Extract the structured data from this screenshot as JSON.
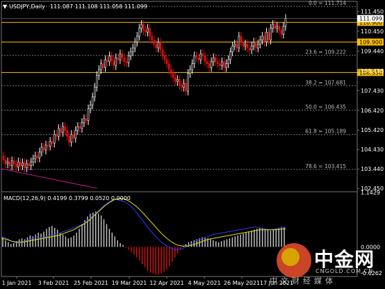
{
  "header": {
    "symbol": "USDJPY,Daily",
    "ohlc": "111.087 111.108 111.058 111.099",
    "macd_label": "MACD(12,26,9) 0.4199 0.3799 0.0520 0.0000"
  },
  "colors": {
    "bull": "#ffffff",
    "bear": "#e01010",
    "level": "#ffbf00",
    "grid": "#777777",
    "macd_line": "#2a3cff",
    "signal_line": "#e6e600",
    "trendline": "#c0188f"
  },
  "watermark": {
    "brand": "中金网",
    "site": "CNGOLD.COM.CN",
    "tagline": "中文财经媒体"
  },
  "chart_data": [
    {
      "type": "candlestick",
      "title": "USDJPY,Daily",
      "ylim": [
        102.28,
        111.97
      ],
      "y_ticks": [
        "111.450",
        "110.450",
        "109.440",
        "108.430",
        "107.430",
        "106.420",
        "105.420",
        "104.430",
        "103.440",
        "102.450"
      ],
      "x_ticks": [
        "1 Jan 2021",
        "3 Feb 2021",
        "25 Feb 2021",
        "19 Mar 2021",
        "12 Apr 2021",
        "4 May 2021",
        "26 May 2021",
        "17 Jun 2021"
      ],
      "last_price": "111.099",
      "levels": [
        {
          "label": "110.900",
          "value": 110.9
        },
        {
          "label": "109.900",
          "value": 109.9
        },
        {
          "label": "108.350",
          "value": 108.35
        }
      ],
      "fibonacci": [
        {
          "label": "0.0 = 111.714",
          "value": 111.714
        },
        {
          "label": "23.6 = 109.222",
          "value": 109.222
        },
        {
          "label": "38.2 = 107.681",
          "value": 107.681
        },
        {
          "label": "50.0 = 106.435",
          "value": 106.435
        },
        {
          "label": "61.8 = 105.189",
          "value": 105.189
        },
        {
          "label": "78.6 = 103.415",
          "value": 103.415
        }
      ],
      "trendline": [
        [
          103.45,
          0
        ],
        [
          102.45,
          0.27
        ]
      ],
      "close": [
        103.9,
        103.7,
        103.8,
        103.6,
        103.85,
        103.7,
        103.55,
        103.8,
        103.6,
        103.75,
        103.5,
        103.7,
        103.6,
        103.8,
        103.95,
        104.1,
        104.0,
        104.3,
        104.55,
        104.4,
        104.65,
        104.6,
        104.85,
        104.75,
        105.2,
        105.1,
        105.5,
        105.3,
        105.6,
        105.4,
        105.1,
        104.8,
        105.2,
        105.0,
        105.4,
        105.6,
        105.5,
        105.8,
        106.0,
        105.9,
        106.5,
        106.7,
        107.1,
        107.6,
        108.2,
        108.5,
        108.8,
        108.6,
        109.0,
        108.9,
        109.2,
        108.95,
        108.7,
        109.1,
        109.0,
        109.3,
        109.1,
        108.9,
        108.85,
        109.2,
        109.4,
        109.6,
        109.9,
        110.2,
        110.6,
        110.8,
        110.5,
        110.4,
        110.6,
        110.2,
        110.0,
        109.8,
        109.6,
        109.9,
        109.5,
        109.2,
        109.0,
        108.8,
        108.5,
        108.3,
        108.1,
        107.9,
        108.0,
        107.7,
        107.6,
        107.8,
        107.4,
        108.3,
        108.5,
        108.8,
        109.2,
        109.1,
        109.0,
        109.3,
        109.2,
        108.9,
        108.8,
        108.6,
        108.9,
        109.1,
        108.9,
        108.8,
        108.7,
        108.9,
        108.6,
        108.8,
        109.0,
        109.4,
        109.7,
        109.8,
        109.6,
        110.2,
        109.9,
        109.7,
        109.8,
        109.6,
        109.5,
        109.7,
        109.9,
        109.6,
        109.8,
        110.0,
        110.2,
        109.9,
        110.4,
        110.0,
        110.6,
        110.8,
        110.6,
        110.7,
        110.5,
        110.3,
        110.7,
        111.1
      ],
      "ranges": {
        "first_open": 104.1,
        "wick": 0.22
      }
    },
    {
      "type": "macd",
      "title": "MACD(12,26,9) 0.4199 0.3799 0.0520 0.0000",
      "ylim": [
        -0.62,
        1.1429
      ],
      "y_ticks": [
        "1.1429",
        "0.0000",
        "-0.6262"
      ],
      "histogram": [
        0.2,
        0.14,
        0.1,
        0.06,
        0.08,
        0.12,
        0.16,
        0.18,
        0.16,
        0.2,
        0.24,
        0.22,
        0.26,
        0.3,
        0.28,
        0.32,
        0.38,
        0.42,
        0.44,
        0.4,
        0.36,
        0.3,
        0.26,
        0.22,
        0.18,
        0.2,
        0.24,
        0.3,
        0.38,
        0.48,
        0.56,
        0.64,
        0.7,
        0.72,
        0.74,
        0.7,
        0.66,
        0.58,
        0.48,
        0.38,
        0.3,
        0.22,
        0.14,
        0.08,
        0.04,
        -0.02,
        -0.06,
        -0.1,
        -0.16,
        -0.22,
        -0.28,
        -0.36,
        -0.42,
        -0.5,
        -0.54,
        -0.56,
        -0.58,
        -0.58,
        -0.56,
        -0.52,
        -0.48,
        -0.4,
        -0.32,
        -0.22,
        -0.14,
        -0.06,
        0.02,
        0.06,
        0.1,
        0.12,
        0.14,
        0.16,
        0.18,
        0.2,
        0.2,
        0.18,
        0.16,
        0.14,
        0.12,
        0.1,
        0.12,
        0.14,
        0.16,
        0.18,
        0.2,
        0.22,
        0.24,
        0.26,
        0.28,
        0.3,
        0.32,
        0.34,
        0.36,
        0.38,
        0.4,
        0.4,
        0.38,
        0.36,
        0.34,
        0.36,
        0.38,
        0.4,
        0.42,
        0.42
      ],
      "macd_line": [
        0.22,
        0.18,
        0.12,
        0.08,
        0.1,
        0.14,
        0.18,
        0.2,
        0.18,
        0.22,
        0.26,
        0.28,
        0.32,
        0.36,
        0.4,
        0.44,
        0.5,
        0.58,
        0.68,
        0.78,
        0.88,
        0.96,
        1.0,
        0.98,
        0.94,
        0.86,
        0.74,
        0.6,
        0.46,
        0.32,
        0.2,
        0.1,
        0.02,
        -0.04,
        -0.06,
        -0.04,
        0.02,
        0.08,
        0.14,
        0.18,
        0.22,
        0.26,
        0.28,
        0.3,
        0.32,
        0.34,
        0.36,
        0.38,
        0.4,
        0.42,
        0.4,
        0.38,
        0.36,
        0.38,
        0.4,
        0.42
      ],
      "signal_line": [
        0.18,
        0.16,
        0.12,
        0.1,
        0.1,
        0.12,
        0.14,
        0.16,
        0.18,
        0.2,
        0.22,
        0.24,
        0.28,
        0.32,
        0.36,
        0.42,
        0.48,
        0.56,
        0.66,
        0.76,
        0.86,
        0.94,
        1.0,
        1.02,
        1.0,
        0.94,
        0.86,
        0.76,
        0.64,
        0.52,
        0.4,
        0.28,
        0.18,
        0.1,
        0.04,
        0.02,
        0.02,
        0.04,
        0.08,
        0.12,
        0.16,
        0.18,
        0.2,
        0.22,
        0.24,
        0.26,
        0.28,
        0.3,
        0.32,
        0.34,
        0.36,
        0.36,
        0.36,
        0.36,
        0.37,
        0.38
      ]
    }
  ]
}
